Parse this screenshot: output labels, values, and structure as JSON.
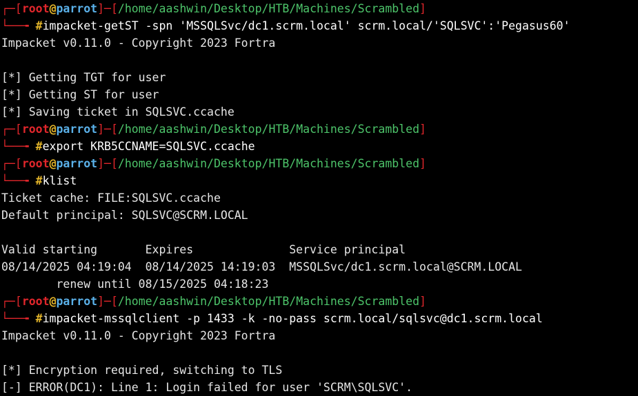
{
  "prompt": {
    "top_left": "┌─",
    "bottom_left": "└──╼ ",
    "user": "root",
    "at": "@",
    "host": "parrot",
    "dash": "─",
    "path": "/home/aashwin/Desktop/HTB/Machines/Scrambled",
    "hash": "#"
  },
  "cmd1": "impacket-getST -spn 'MSSQLSvc/dc1.scrm.local' scrm.local/'SQLSVC':'Pegasus60'",
  "out1": [
    "Impacket v0.11.0 - Copyright 2023 Fortra",
    "",
    "[*] Getting TGT for user",
    "[*] Getting ST for user",
    "[*] Saving ticket in SQLSVC.ccache"
  ],
  "cmd2": "export KRB5CCNAME=SQLSVC.ccache",
  "cmd3": "klist",
  "out3": [
    "Ticket cache: FILE:SQLSVC.ccache",
    "Default principal: SQLSVC@SCRM.LOCAL",
    "",
    "Valid starting       Expires              Service principal",
    "08/14/2025 04:19:04  08/14/2025 14:19:03  MSSQLSvc/dc1.scrm.local@SCRM.LOCAL",
    "        renew until 08/15/2025 04:18:23"
  ],
  "cmd4": "impacket-mssqlclient -p 1433 -k -no-pass scrm.local/sqlsvc@dc1.scrm.local",
  "out4": [
    "Impacket v0.11.0 - Copyright 2023 Fortra",
    "",
    "[*] Encryption required, switching to TLS",
    "[-] ERROR(DC1): Line 1: Login failed for user 'SCRM\\SQLSVC'."
  ]
}
